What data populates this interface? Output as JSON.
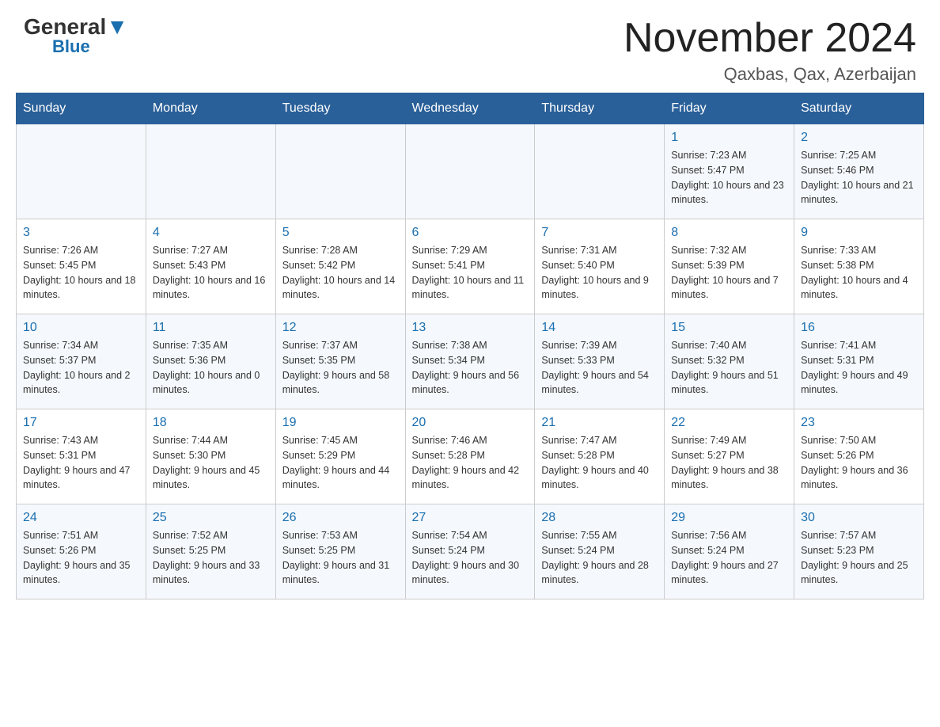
{
  "header": {
    "logo_general": "General",
    "logo_blue": "Blue",
    "month": "November 2024",
    "location": "Qaxbas, Qax, Azerbaijan"
  },
  "weekdays": [
    "Sunday",
    "Monday",
    "Tuesday",
    "Wednesday",
    "Thursday",
    "Friday",
    "Saturday"
  ],
  "weeks": [
    [
      {
        "day": "",
        "sunrise": "",
        "sunset": "",
        "daylight": ""
      },
      {
        "day": "",
        "sunrise": "",
        "sunset": "",
        "daylight": ""
      },
      {
        "day": "",
        "sunrise": "",
        "sunset": "",
        "daylight": ""
      },
      {
        "day": "",
        "sunrise": "",
        "sunset": "",
        "daylight": ""
      },
      {
        "day": "",
        "sunrise": "",
        "sunset": "",
        "daylight": ""
      },
      {
        "day": "1",
        "sunrise": "Sunrise: 7:23 AM",
        "sunset": "Sunset: 5:47 PM",
        "daylight": "Daylight: 10 hours and 23 minutes."
      },
      {
        "day": "2",
        "sunrise": "Sunrise: 7:25 AM",
        "sunset": "Sunset: 5:46 PM",
        "daylight": "Daylight: 10 hours and 21 minutes."
      }
    ],
    [
      {
        "day": "3",
        "sunrise": "Sunrise: 7:26 AM",
        "sunset": "Sunset: 5:45 PM",
        "daylight": "Daylight: 10 hours and 18 minutes."
      },
      {
        "day": "4",
        "sunrise": "Sunrise: 7:27 AM",
        "sunset": "Sunset: 5:43 PM",
        "daylight": "Daylight: 10 hours and 16 minutes."
      },
      {
        "day": "5",
        "sunrise": "Sunrise: 7:28 AM",
        "sunset": "Sunset: 5:42 PM",
        "daylight": "Daylight: 10 hours and 14 minutes."
      },
      {
        "day": "6",
        "sunrise": "Sunrise: 7:29 AM",
        "sunset": "Sunset: 5:41 PM",
        "daylight": "Daylight: 10 hours and 11 minutes."
      },
      {
        "day": "7",
        "sunrise": "Sunrise: 7:31 AM",
        "sunset": "Sunset: 5:40 PM",
        "daylight": "Daylight: 10 hours and 9 minutes."
      },
      {
        "day": "8",
        "sunrise": "Sunrise: 7:32 AM",
        "sunset": "Sunset: 5:39 PM",
        "daylight": "Daylight: 10 hours and 7 minutes."
      },
      {
        "day": "9",
        "sunrise": "Sunrise: 7:33 AM",
        "sunset": "Sunset: 5:38 PM",
        "daylight": "Daylight: 10 hours and 4 minutes."
      }
    ],
    [
      {
        "day": "10",
        "sunrise": "Sunrise: 7:34 AM",
        "sunset": "Sunset: 5:37 PM",
        "daylight": "Daylight: 10 hours and 2 minutes."
      },
      {
        "day": "11",
        "sunrise": "Sunrise: 7:35 AM",
        "sunset": "Sunset: 5:36 PM",
        "daylight": "Daylight: 10 hours and 0 minutes."
      },
      {
        "day": "12",
        "sunrise": "Sunrise: 7:37 AM",
        "sunset": "Sunset: 5:35 PM",
        "daylight": "Daylight: 9 hours and 58 minutes."
      },
      {
        "day": "13",
        "sunrise": "Sunrise: 7:38 AM",
        "sunset": "Sunset: 5:34 PM",
        "daylight": "Daylight: 9 hours and 56 minutes."
      },
      {
        "day": "14",
        "sunrise": "Sunrise: 7:39 AM",
        "sunset": "Sunset: 5:33 PM",
        "daylight": "Daylight: 9 hours and 54 minutes."
      },
      {
        "day": "15",
        "sunrise": "Sunrise: 7:40 AM",
        "sunset": "Sunset: 5:32 PM",
        "daylight": "Daylight: 9 hours and 51 minutes."
      },
      {
        "day": "16",
        "sunrise": "Sunrise: 7:41 AM",
        "sunset": "Sunset: 5:31 PM",
        "daylight": "Daylight: 9 hours and 49 minutes."
      }
    ],
    [
      {
        "day": "17",
        "sunrise": "Sunrise: 7:43 AM",
        "sunset": "Sunset: 5:31 PM",
        "daylight": "Daylight: 9 hours and 47 minutes."
      },
      {
        "day": "18",
        "sunrise": "Sunrise: 7:44 AM",
        "sunset": "Sunset: 5:30 PM",
        "daylight": "Daylight: 9 hours and 45 minutes."
      },
      {
        "day": "19",
        "sunrise": "Sunrise: 7:45 AM",
        "sunset": "Sunset: 5:29 PM",
        "daylight": "Daylight: 9 hours and 44 minutes."
      },
      {
        "day": "20",
        "sunrise": "Sunrise: 7:46 AM",
        "sunset": "Sunset: 5:28 PM",
        "daylight": "Daylight: 9 hours and 42 minutes."
      },
      {
        "day": "21",
        "sunrise": "Sunrise: 7:47 AM",
        "sunset": "Sunset: 5:28 PM",
        "daylight": "Daylight: 9 hours and 40 minutes."
      },
      {
        "day": "22",
        "sunrise": "Sunrise: 7:49 AM",
        "sunset": "Sunset: 5:27 PM",
        "daylight": "Daylight: 9 hours and 38 minutes."
      },
      {
        "day": "23",
        "sunrise": "Sunrise: 7:50 AM",
        "sunset": "Sunset: 5:26 PM",
        "daylight": "Daylight: 9 hours and 36 minutes."
      }
    ],
    [
      {
        "day": "24",
        "sunrise": "Sunrise: 7:51 AM",
        "sunset": "Sunset: 5:26 PM",
        "daylight": "Daylight: 9 hours and 35 minutes."
      },
      {
        "day": "25",
        "sunrise": "Sunrise: 7:52 AM",
        "sunset": "Sunset: 5:25 PM",
        "daylight": "Daylight: 9 hours and 33 minutes."
      },
      {
        "day": "26",
        "sunrise": "Sunrise: 7:53 AM",
        "sunset": "Sunset: 5:25 PM",
        "daylight": "Daylight: 9 hours and 31 minutes."
      },
      {
        "day": "27",
        "sunrise": "Sunrise: 7:54 AM",
        "sunset": "Sunset: 5:24 PM",
        "daylight": "Daylight: 9 hours and 30 minutes."
      },
      {
        "day": "28",
        "sunrise": "Sunrise: 7:55 AM",
        "sunset": "Sunset: 5:24 PM",
        "daylight": "Daylight: 9 hours and 28 minutes."
      },
      {
        "day": "29",
        "sunrise": "Sunrise: 7:56 AM",
        "sunset": "Sunset: 5:24 PM",
        "daylight": "Daylight: 9 hours and 27 minutes."
      },
      {
        "day": "30",
        "sunrise": "Sunrise: 7:57 AM",
        "sunset": "Sunset: 5:23 PM",
        "daylight": "Daylight: 9 hours and 25 minutes."
      }
    ]
  ]
}
